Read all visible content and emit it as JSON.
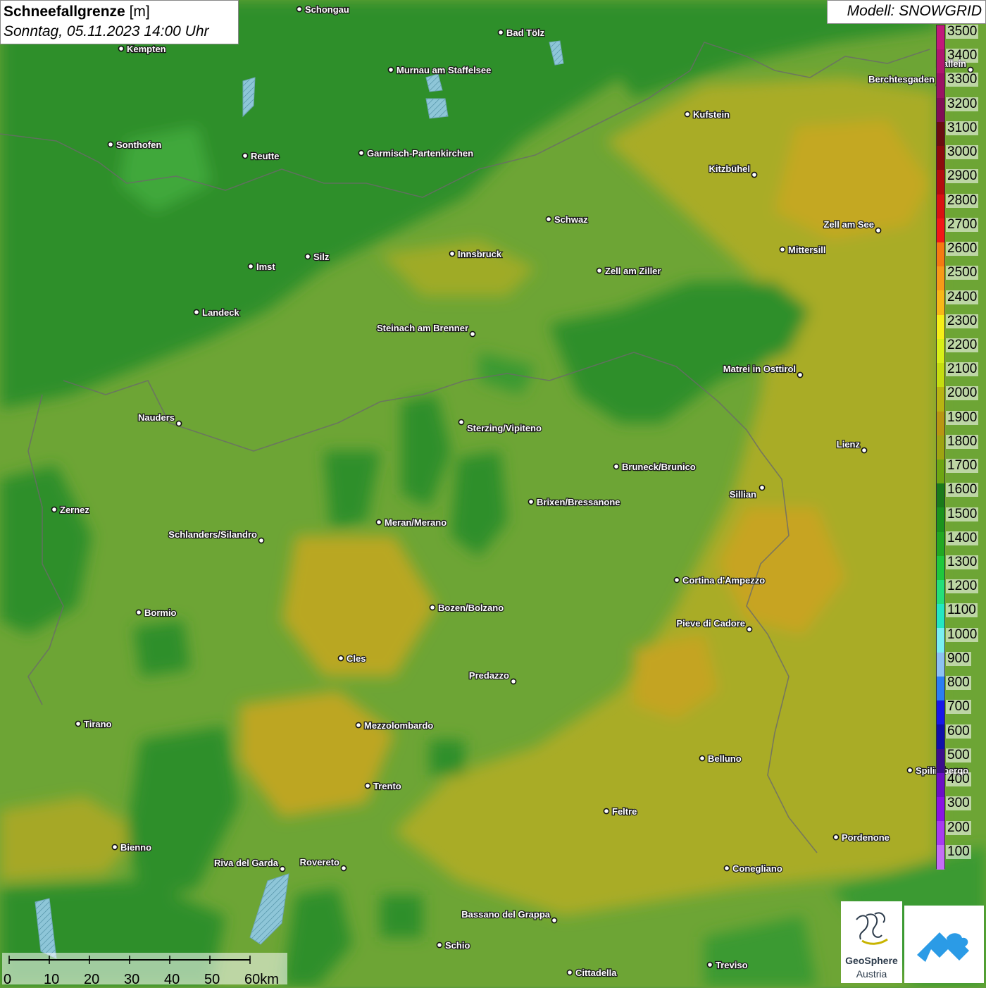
{
  "title": {
    "main": "Schneefallgrenze",
    "unit": "[m]",
    "date": "Sonntag, 05.11.2023 14:00 Uhr"
  },
  "model": "Modell: SNOWGRID",
  "legend": {
    "labels": [
      "3500",
      "3400",
      "3300",
      "3200",
      "3100",
      "3000",
      "2900",
      "2800",
      "2700",
      "2600",
      "2500",
      "2400",
      "2300",
      "2200",
      "2100",
      "2000",
      "1900",
      "1800",
      "1700",
      "1600",
      "1500",
      "1400",
      "1300",
      "1200",
      "1100",
      "1000",
      "900",
      "800",
      "700",
      "600",
      "500",
      "400",
      "300",
      "200",
      "100"
    ],
    "colors": [
      "#c21a7a",
      "#b0166f",
      "#9a1263",
      "#810e55",
      "#6a0e10",
      "#8c0c0c",
      "#b30d0d",
      "#d81212",
      "#f21717",
      "#f57a12",
      "#f79a18",
      "#f8b818",
      "#f7ef18",
      "#d8f018",
      "#c5dd10",
      "#b8b412",
      "#b89612",
      "#9ea412",
      "#6ea512",
      "#1a7a1a",
      "#1b931d",
      "#22a822",
      "#1fc83d",
      "#24e07a",
      "#24e8c2",
      "#7af0f2",
      "#8dc2f2",
      "#2b7ef2",
      "#1717e8",
      "#1010a8",
      "#3c0e8c",
      "#6c10c4",
      "#8a14e2",
      "#a83cf0",
      "#c46ef6"
    ]
  },
  "scalebar": {
    "ticks": [
      "0",
      "10",
      "20",
      "30",
      "40",
      "50",
      "60km"
    ]
  },
  "logos": {
    "geosphere_line1": "GeoSphere",
    "geosphere_line2": "Austria"
  },
  "cities": [
    {
      "name": "Schongau"
    },
    {
      "name": "Kempten"
    },
    {
      "name": "Bad Tölz"
    },
    {
      "name": "Murnau am Staffelsee"
    },
    {
      "name": "Sonthofen"
    },
    {
      "name": "Reutte"
    },
    {
      "name": "Garmisch-Partenkirchen"
    },
    {
      "name": "Kufstein"
    },
    {
      "name": "Berchtesgaden"
    },
    {
      "name": "Kitzbühel"
    },
    {
      "name": "Schwaz"
    },
    {
      "name": "Zell am See"
    },
    {
      "name": "Innsbruck"
    },
    {
      "name": "Mittersill"
    },
    {
      "name": "Imst"
    },
    {
      "name": "Silz"
    },
    {
      "name": "Zell am Ziller"
    },
    {
      "name": "Landeck"
    },
    {
      "name": "Steinach am Brenner"
    },
    {
      "name": "Matrei in Osttirol"
    },
    {
      "name": "Nauders"
    },
    {
      "name": "Sterzing/Vipiteno"
    },
    {
      "name": "Lienz"
    },
    {
      "name": "Bruneck/Brunico"
    },
    {
      "name": "Sillian"
    },
    {
      "name": "Zernez"
    },
    {
      "name": "Brixen/Bressanone"
    },
    {
      "name": "Meran/Merano"
    },
    {
      "name": "Schlanders/Silandro"
    },
    {
      "name": "Cortina d'Ampezzo"
    },
    {
      "name": "Bozen/Bolzano"
    },
    {
      "name": "Bormio"
    },
    {
      "name": "Pieve di Cadore"
    },
    {
      "name": "Cles"
    },
    {
      "name": "Predazzo"
    },
    {
      "name": "Tirano"
    },
    {
      "name": "Mezzolombardo"
    },
    {
      "name": "Belluno"
    },
    {
      "name": "Spilimbergo"
    },
    {
      "name": "Trento"
    },
    {
      "name": "Feltre"
    },
    {
      "name": "Pordenone"
    },
    {
      "name": "Bienno"
    },
    {
      "name": "Riva del Garda"
    },
    {
      "name": "Rovereto"
    },
    {
      "name": "Conegliano"
    },
    {
      "name": "Bassano del Grappa"
    },
    {
      "name": "Schio"
    },
    {
      "name": "Treviso"
    },
    {
      "name": "Cittadella"
    },
    {
      "name": "Hallein"
    }
  ]
}
